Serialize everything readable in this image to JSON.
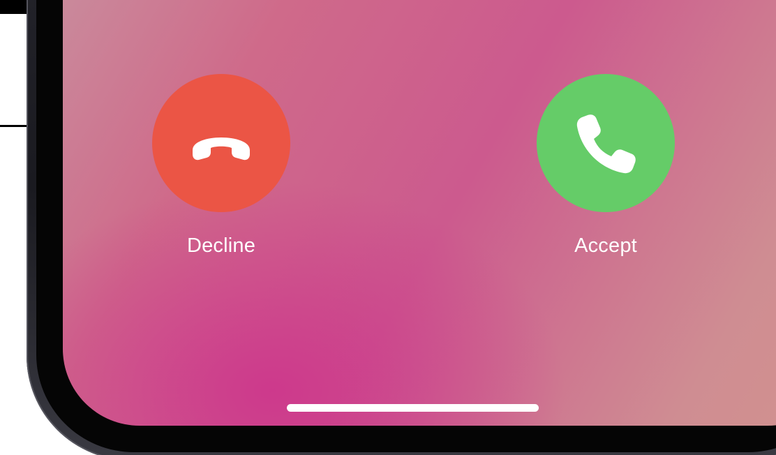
{
  "incoming_call": {
    "decline": {
      "label": "Decline",
      "icon": "phone-hangup-icon",
      "color": "#eb5545"
    },
    "accept": {
      "label": "Accept",
      "icon": "phone-icon",
      "color": "#65cc68"
    }
  },
  "home_indicator": {
    "color": "#ffffff"
  }
}
